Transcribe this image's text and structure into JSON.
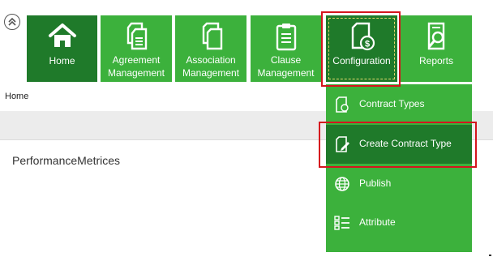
{
  "nav": {
    "tiles": [
      {
        "label": "Home",
        "icon": "home-icon"
      },
      {
        "label": "Agreement Management",
        "icon": "agreement-documents-icon"
      },
      {
        "label": "Association Management",
        "icon": "association-documents-icon"
      },
      {
        "label": "Clause Management",
        "icon": "clipboard-icon"
      },
      {
        "label": "Configuration",
        "icon": "document-dollar-icon"
      },
      {
        "label": "Reports",
        "icon": "report-search-icon"
      }
    ]
  },
  "breadcrumb": "Home",
  "panel": {
    "title": "PerformanceMetrices"
  },
  "config_menu": {
    "items": [
      {
        "label": "Contract Types",
        "icon": "contract-types-icon"
      },
      {
        "label": "Create Contract Type",
        "icon": "edit-document-icon"
      },
      {
        "label": "Publish",
        "icon": "globe-icon"
      },
      {
        "label": "Attribute",
        "icon": "list-icon"
      }
    ]
  },
  "colors": {
    "tile_green": "#3cb13c",
    "tile_dark_green": "#1f7a2a",
    "highlight_red": "#d5151e"
  }
}
